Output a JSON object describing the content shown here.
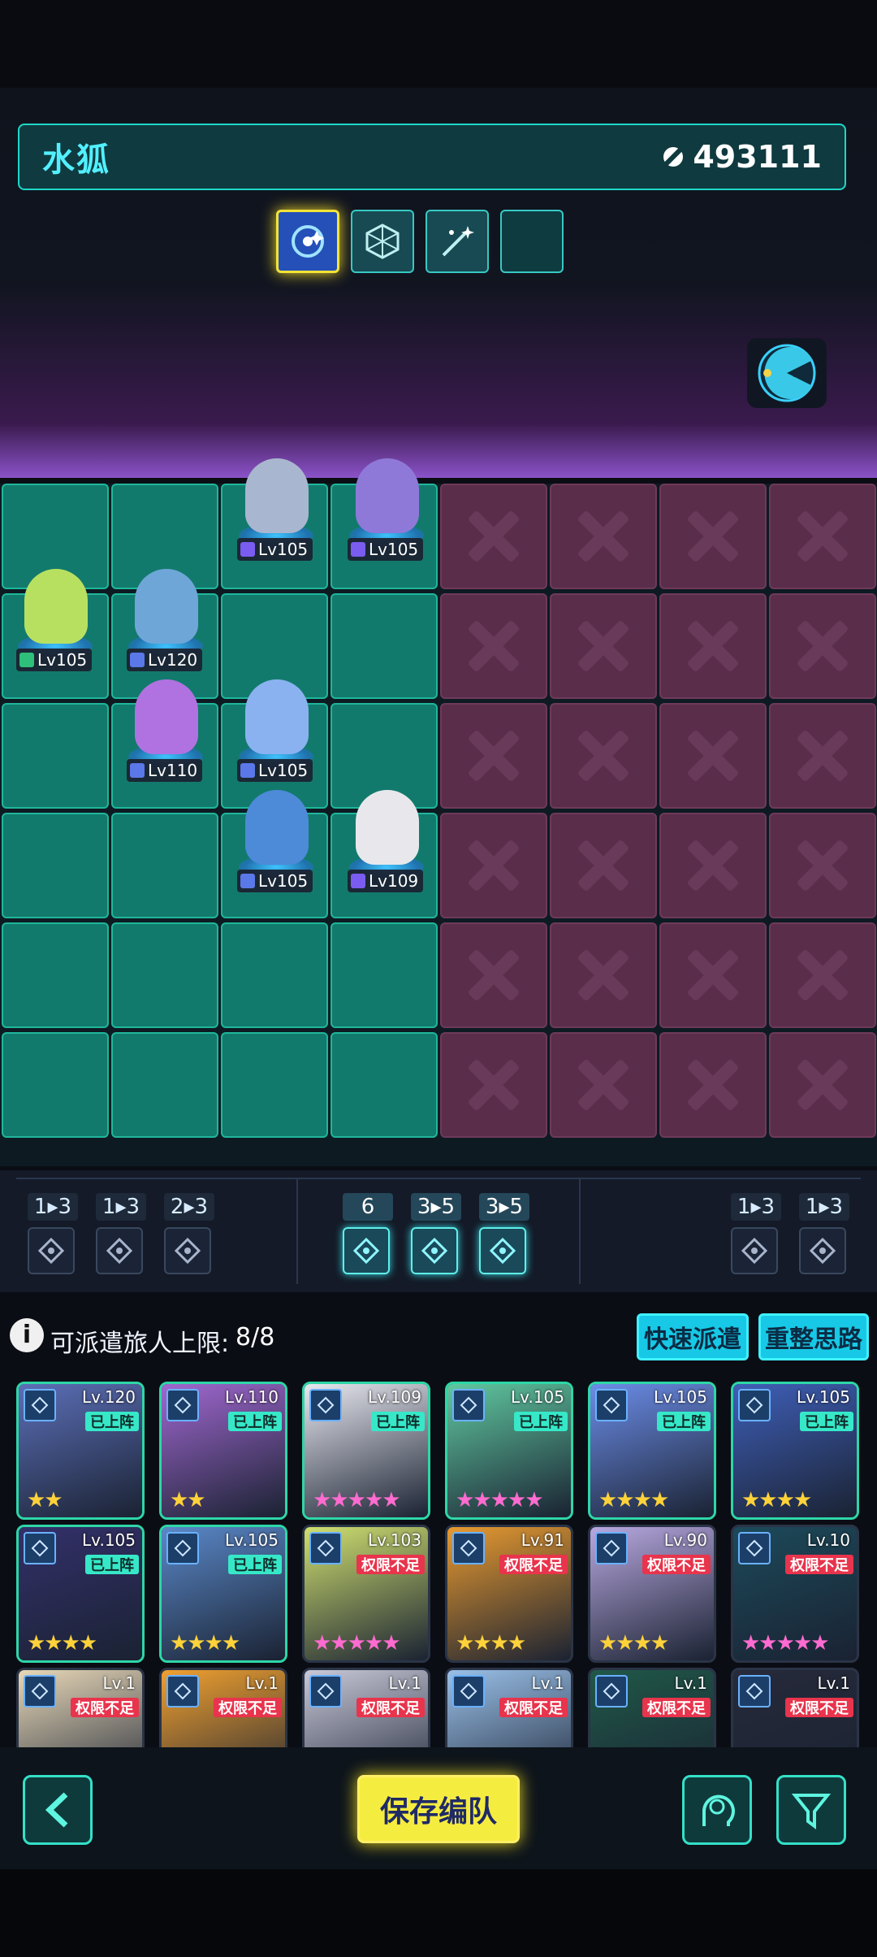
{
  "header": {
    "team_name": "水狐",
    "power": "493111"
  },
  "colors": {
    "accent": "#1fd8c9",
    "save": "#f5ec40",
    "deployed_badge": "#36e8c8",
    "locked_badge": "#e8344c"
  },
  "skill_slots": [
    "galaxy-icon",
    "hex-cube-icon",
    "sparkle-wand-icon",
    "empty-slot"
  ],
  "board_units": [
    {
      "level": "Lv105",
      "class": "shield"
    },
    {
      "level": "Lv105",
      "class": "shield"
    },
    {
      "level": "Lv105",
      "class": "arrow-up"
    },
    {
      "level": "Lv120",
      "class": "diamond"
    },
    {
      "level": "Lv110",
      "class": "diamond"
    },
    {
      "level": "Lv105",
      "class": "diamond"
    },
    {
      "level": "Lv105",
      "class": "diamond"
    },
    {
      "level": "Lv109",
      "class": "shield"
    }
  ],
  "synergies": [
    {
      "count": "1▸3",
      "icon": "mountain-peak-icon"
    },
    {
      "count": "1▸3",
      "icon": "shuriken-icon"
    },
    {
      "count": "2▸3",
      "icon": "tribal-mark-icon"
    },
    {
      "count": "6",
      "icon": "vortex-icon"
    },
    {
      "count": "3▸5",
      "icon": "shield-crest-icon"
    },
    {
      "count": "3▸5",
      "icon": "diamond-crest-icon"
    },
    {
      "count": "1▸3",
      "icon": "arrow-cross-icon"
    },
    {
      "count": "1▸3",
      "icon": "arrow-up-icon"
    }
  ],
  "limit": {
    "label": "可派遣旅人上限:",
    "value": "8/8"
  },
  "buttons": {
    "quick_dispatch": "快速派遣",
    "reset": "重整思路",
    "save": "保存编队"
  },
  "roster": [
    {
      "level": "Lv.120",
      "status": "已上阵",
      "stars": "★★"
    },
    {
      "level": "Lv.110",
      "status": "已上阵",
      "stars": "★★"
    },
    {
      "level": "Lv.109",
      "status": "已上阵",
      "stars": "★★★★★"
    },
    {
      "level": "Lv.105",
      "status": "已上阵",
      "stars": "★★★★★"
    },
    {
      "level": "Lv.105",
      "status": "已上阵",
      "stars": "★★★★"
    },
    {
      "level": "Lv.105",
      "status": "已上阵",
      "stars": "★★★★"
    },
    {
      "level": "Lv.105",
      "status": "已上阵",
      "stars": "★★★★"
    },
    {
      "level": "Lv.105",
      "status": "已上阵",
      "stars": "★★★★"
    },
    {
      "level": "Lv.103",
      "status": "权限不足",
      "stars": "★★★★★"
    },
    {
      "level": "Lv.91",
      "status": "权限不足",
      "stars": "★★★★"
    },
    {
      "level": "Lv.90",
      "status": "权限不足",
      "stars": "★★★★"
    },
    {
      "level": "Lv.10",
      "status": "权限不足",
      "stars": "★★★★★"
    },
    {
      "level": "Lv.1",
      "status": "权限不足",
      "stars": ""
    },
    {
      "level": "Lv.1",
      "status": "权限不足",
      "stars": ""
    },
    {
      "level": "Lv.1",
      "status": "权限不足",
      "stars": ""
    },
    {
      "level": "Lv.1",
      "status": "权限不足",
      "stars": ""
    },
    {
      "level": "Lv.1",
      "status": "权限不足",
      "stars": ""
    },
    {
      "level": "Lv.1",
      "status": "权限不足",
      "stars": ""
    }
  ]
}
